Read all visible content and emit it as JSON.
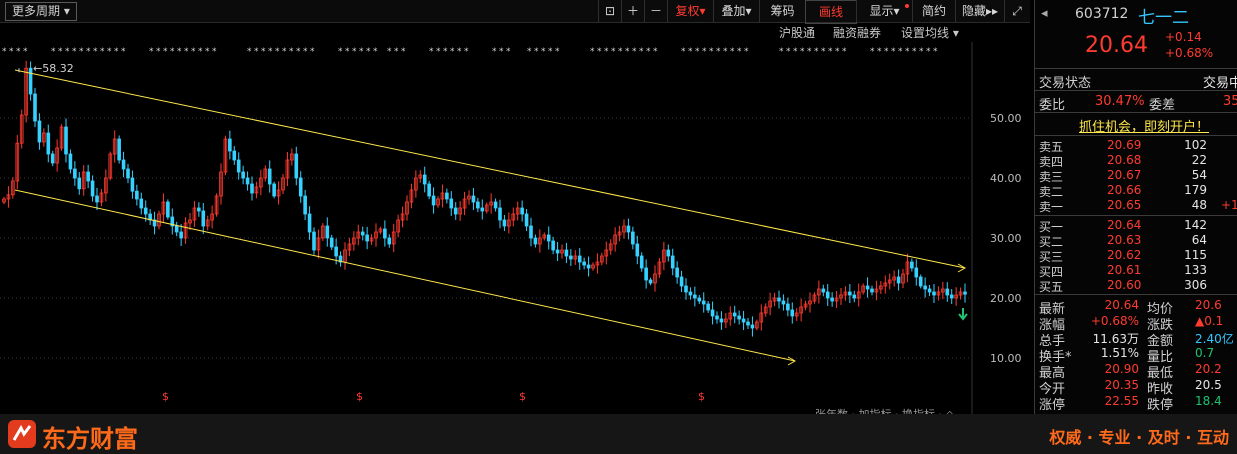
{
  "toolbar": {
    "period_dropdown": "更多周期",
    "right_adjust": "复权",
    "overlay": "叠加",
    "chips": "筹码",
    "draw": "画线",
    "display": "显示",
    "brief": "简约",
    "hide": "隐藏"
  },
  "toolbar2": {
    "hsgt": "沪股通",
    "margin": "融资融券",
    "ma_settings": "设置均线"
  },
  "chart_data": {
    "type": "candlestick",
    "y_ticks": [
      "50.00",
      "40.00",
      "30.00",
      "20.00",
      "10.00"
    ],
    "max_label": "58.32",
    "close_series": [
      36.5,
      37.2,
      39.5,
      45.8,
      50.5,
      58.3,
      54.0,
      49.5,
      46.0,
      47.5,
      44.0,
      42.5,
      45.0,
      48.5,
      44.0,
      41.5,
      40.0,
      38.2,
      41.0,
      39.5,
      37.0,
      36.0,
      37.5,
      40.0,
      44.0,
      46.5,
      43.0,
      41.5,
      40.0,
      37.8,
      36.5,
      35.0,
      34.0,
      33.0,
      32.0,
      34.0,
      36.0,
      33.5,
      32.0,
      31.0,
      30.0,
      32.5,
      33.0,
      35.0,
      34.5,
      32.0,
      33.0,
      34.0,
      37.0,
      41.0,
      46.5,
      44.5,
      43.0,
      41.0,
      40.0,
      39.0,
      37.5,
      38.5,
      40.0,
      41.5,
      39.0,
      37.0,
      38.0,
      40.0,
      43.0,
      44.0,
      40.0,
      37.0,
      34.0,
      31.0,
      28.0,
      30.0,
      32.0,
      30.0,
      28.5,
      27.0,
      26.0,
      28.0,
      29.0,
      30.0,
      31.0,
      30.5,
      29.5,
      30.0,
      31.0,
      31.5,
      30.0,
      29.0,
      31.0,
      33.0,
      34.0,
      36.0,
      38.0,
      40.0,
      40.5,
      39.0,
      37.0,
      35.5,
      36.5,
      37.5,
      36.5,
      35.0,
      34.0,
      35.0,
      36.5,
      37.0,
      36.0,
      35.0,
      34.5,
      35.5,
      36.0,
      35.0,
      33.0,
      32.0,
      33.0,
      34.0,
      35.0,
      34.0,
      32.0,
      30.0,
      29.0,
      30.0,
      30.5,
      29.5,
      28.0,
      27.5,
      28.0,
      27.0,
      26.5,
      27.0,
      26.0,
      25.5,
      25.0,
      25.5,
      26.0,
      27.0,
      28.0,
      29.0,
      30.5,
      31.0,
      32.0,
      31.0,
      29.0,
      27.0,
      25.0,
      23.0,
      22.5,
      24.0,
      26.0,
      28.0,
      27.0,
      25.0,
      23.5,
      22.0,
      21.0,
      20.5,
      20.0,
      19.5,
      19.0,
      18.0,
      17.0,
      16.5,
      16.0,
      16.5,
      17.5,
      17.0,
      16.5,
      16.0,
      15.5,
      15.0,
      16.0,
      17.5,
      18.5,
      19.5,
      20.0,
      19.5,
      19.0,
      18.0,
      17.0,
      17.5,
      18.5,
      19.0,
      19.5,
      20.5,
      21.5,
      21.0,
      20.0,
      19.5,
      20.0,
      20.5,
      21.0,
      20.5,
      20.0,
      21.0,
      22.0,
      21.5,
      21.0,
      21.5,
      22.0,
      22.5,
      23.0,
      23.5,
      22.5,
      24.0,
      26.0,
      25.0,
      23.5,
      22.0,
      21.5,
      21.0,
      20.5,
      21.0,
      21.5,
      20.5,
      20.0,
      20.5,
      21.0,
      20.64
    ],
    "channel_upper": {
      "from": [
        15,
        58.0
      ],
      "to": [
        965,
        25.0
      ]
    },
    "channel_lower": {
      "from": [
        15,
        38.0
      ],
      "to": [
        795,
        9.5
      ]
    }
  },
  "bottom": {
    "brand": "东方财富",
    "slogan": "权威 · 专业 · 及时 · 互动",
    "partial_text": "张年数 · 加指标 · 换指标 · ◇"
  },
  "quote": {
    "code": "603712",
    "name": "七一二",
    "price": "20.64",
    "change": "+0.14",
    "change_pct": "+0.68%",
    "trade_status_label": "交易状态",
    "trade_status_value": "交易中",
    "wb_label": "委比",
    "wb_value": "30.47%",
    "wc_label": "委差",
    "wc_value": "35",
    "promo": "抓住机会，即刻开户！",
    "asks": [
      {
        "label": "卖五",
        "price": "20.69",
        "vol": "102"
      },
      {
        "label": "卖四",
        "price": "20.68",
        "vol": "22"
      },
      {
        "label": "卖三",
        "price": "20.67",
        "vol": "54"
      },
      {
        "label": "卖二",
        "price": "20.66",
        "vol": "179"
      },
      {
        "label": "卖一",
        "price": "20.65",
        "vol": "48",
        "extra": "+1"
      }
    ],
    "bids": [
      {
        "label": "买一",
        "price": "20.64",
        "vol": "142"
      },
      {
        "label": "买二",
        "price": "20.63",
        "vol": "64"
      },
      {
        "label": "买三",
        "price": "20.62",
        "vol": "115"
      },
      {
        "label": "买四",
        "price": "20.61",
        "vol": "133"
      },
      {
        "label": "买五",
        "price": "20.60",
        "vol": "306"
      }
    ],
    "stats": [
      {
        "l1": "最新",
        "v1": "20.64",
        "l2": "均价",
        "v2": "20.6"
      },
      {
        "l1": "涨幅",
        "v1": "+0.68%",
        "l2": "涨跌",
        "v2": "▲0.1"
      },
      {
        "l1": "总手",
        "v1": "11.63万",
        "l2": "金额",
        "v2": "2.40亿"
      },
      {
        "l1": "换手*",
        "v1": "1.51%",
        "l2": "量比",
        "v2": "0.7"
      },
      {
        "l1": "最高",
        "v1": "20.90",
        "l2": "最低",
        "v2": "20.2"
      },
      {
        "l1": "今开",
        "v1": "20.35",
        "l2": "昨收",
        "v2": "20.5"
      },
      {
        "l1": "涨停",
        "v1": "22.55",
        "l2": "跌停",
        "v2": "18.4"
      }
    ]
  }
}
